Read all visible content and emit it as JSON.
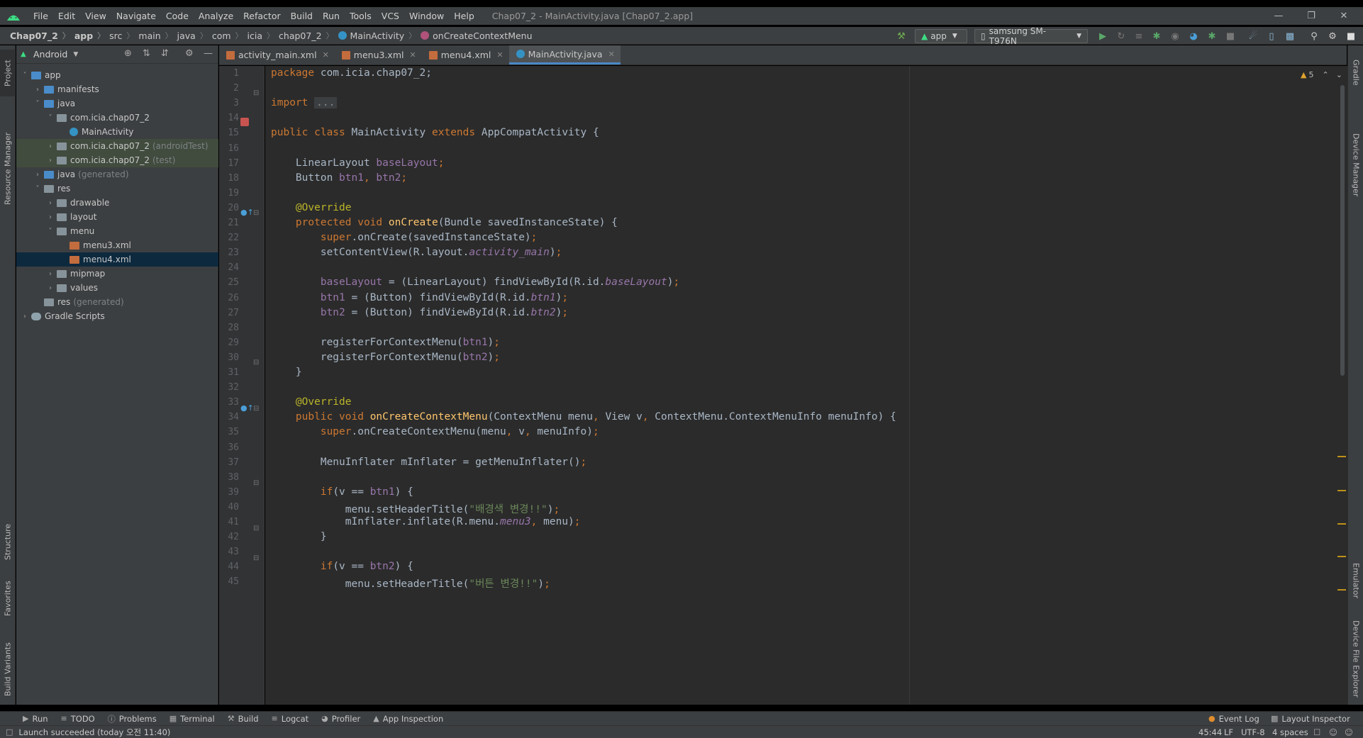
{
  "menubar": {
    "items": [
      "File",
      "Edit",
      "View",
      "Navigate",
      "Code",
      "Analyze",
      "Refactor",
      "Build",
      "Run",
      "Tools",
      "VCS",
      "Window",
      "Help"
    ],
    "window_title": "Chap07_2 - MainActivity.java [Chap07_2.app]"
  },
  "breadcrumb": [
    "Chap07_2",
    "app",
    "src",
    "main",
    "java",
    "com",
    "icia",
    "chap07_2",
    "MainActivity",
    "onCreateContextMenu"
  ],
  "toolbar": {
    "run_config": "app",
    "device": "samsung SM-T976N"
  },
  "project": {
    "view_mode": "Android",
    "tree": [
      {
        "label": "app",
        "level": 0,
        "chev": "v",
        "icon": "folder-blue",
        "muted": "",
        "state": ""
      },
      {
        "label": "manifests",
        "level": 1,
        "chev": ">",
        "icon": "folder-blue",
        "muted": "",
        "state": ""
      },
      {
        "label": "java",
        "level": 1,
        "chev": "v",
        "icon": "folder-blue",
        "muted": "",
        "state": ""
      },
      {
        "label": "com.icia.chap07_2",
        "level": 2,
        "chev": "v",
        "icon": "folder",
        "muted": "",
        "state": ""
      },
      {
        "label": "MainActivity",
        "level": 3,
        "chev": "",
        "icon": "java",
        "muted": "",
        "state": ""
      },
      {
        "label": "com.icia.chap07_2",
        "level": 2,
        "chev": ">",
        "icon": "folder",
        "muted": "(androidTest)",
        "state": "green"
      },
      {
        "label": "com.icia.chap07_2",
        "level": 2,
        "chev": ">",
        "icon": "folder",
        "muted": "(test)",
        "state": "green"
      },
      {
        "label": "java",
        "level": 1,
        "chev": ">",
        "icon": "folder-blue",
        "muted": "(generated)",
        "state": ""
      },
      {
        "label": "res",
        "level": 1,
        "chev": "v",
        "icon": "folder",
        "muted": "",
        "state": ""
      },
      {
        "label": "drawable",
        "level": 2,
        "chev": ">",
        "icon": "folder",
        "muted": "",
        "state": ""
      },
      {
        "label": "layout",
        "level": 2,
        "chev": ">",
        "icon": "folder",
        "muted": "",
        "state": ""
      },
      {
        "label": "menu",
        "level": 2,
        "chev": "v",
        "icon": "folder",
        "muted": "",
        "state": ""
      },
      {
        "label": "menu3.xml",
        "level": 3,
        "chev": "",
        "icon": "xml",
        "muted": "",
        "state": ""
      },
      {
        "label": "menu4.xml",
        "level": 3,
        "chev": "",
        "icon": "xml",
        "muted": "",
        "state": "selected"
      },
      {
        "label": "mipmap",
        "level": 2,
        "chev": ">",
        "icon": "folder",
        "muted": "",
        "state": ""
      },
      {
        "label": "values",
        "level": 2,
        "chev": ">",
        "icon": "folder",
        "muted": "",
        "state": ""
      },
      {
        "label": "res",
        "level": 1,
        "chev": "",
        "icon": "folder",
        "muted": "(generated)",
        "state": ""
      },
      {
        "label": "Gradle Scripts",
        "level": 0,
        "chev": ">",
        "icon": "gradle",
        "muted": "",
        "state": ""
      }
    ]
  },
  "tabs": [
    {
      "label": "activity_main.xml",
      "icon": "xml",
      "active": false
    },
    {
      "label": "menu3.xml",
      "icon": "xml",
      "active": false
    },
    {
      "label": "menu4.xml",
      "icon": "xml",
      "active": false
    },
    {
      "label": "MainActivity.java",
      "icon": "java",
      "active": true
    }
  ],
  "editor": {
    "warning_count": "5",
    "line_numbers": [
      "1",
      "2",
      "3",
      "14",
      "15",
      "16",
      "17",
      "18",
      "19",
      "20",
      "21",
      "22",
      "23",
      "24",
      "25",
      "26",
      "27",
      "28",
      "29",
      "30",
      "31",
      "32",
      "33",
      "34",
      "35",
      "36",
      "37",
      "38",
      "39",
      "40",
      "41",
      "42",
      "43",
      "44",
      "45"
    ],
    "code_lines": [
      [
        {
          "t": "kw",
          "v": "package "
        },
        {
          "t": "",
          "v": "com.icia.chap07_2;"
        }
      ],
      [],
      [
        {
          "t": "kw",
          "v": "import "
        },
        {
          "t": "fold",
          "v": "..."
        }
      ],
      [],
      [
        {
          "t": "kw",
          "v": "public class "
        },
        {
          "t": "",
          "v": "MainActivity "
        },
        {
          "t": "kw",
          "v": "extends "
        },
        {
          "t": "",
          "v": "AppCompatActivity {"
        }
      ],
      [],
      [
        {
          "t": "",
          "v": "    LinearLayout "
        },
        {
          "t": "fld",
          "v": "baseLayout"
        },
        {
          "t": "kw",
          "v": ";"
        }
      ],
      [
        {
          "t": "",
          "v": "    Button "
        },
        {
          "t": "fld",
          "v": "btn1"
        },
        {
          "t": "kw",
          "v": ", "
        },
        {
          "t": "fld",
          "v": "btn2"
        },
        {
          "t": "kw",
          "v": ";"
        }
      ],
      [],
      [
        {
          "t": "ann",
          "v": "    @Override"
        }
      ],
      [
        {
          "t": "kw",
          "v": "    protected void "
        },
        {
          "t": "fn",
          "v": "onCreate"
        },
        {
          "t": "",
          "v": "(Bundle savedInstanceState) {"
        }
      ],
      [
        {
          "t": "kw",
          "v": "        super"
        },
        {
          "t": "",
          "v": ".onCreate(savedInstanceState)"
        },
        {
          "t": "kw",
          "v": ";"
        }
      ],
      [
        {
          "t": "",
          "v": "        setContentView(R.layout."
        },
        {
          "t": "fldi",
          "v": "activity_main"
        },
        {
          "t": "",
          "v": ")"
        },
        {
          "t": "kw",
          "v": ";"
        }
      ],
      [],
      [
        {
          "t": "fld",
          "v": "        baseLayout "
        },
        {
          "t": "",
          "v": "= (LinearLayout) findViewById(R.id."
        },
        {
          "t": "fldi",
          "v": "baseLayout"
        },
        {
          "t": "",
          "v": ")"
        },
        {
          "t": "kw",
          "v": ";"
        }
      ],
      [
        {
          "t": "fld",
          "v": "        btn1 "
        },
        {
          "t": "",
          "v": "= (Button) findViewById(R.id."
        },
        {
          "t": "fldi",
          "v": "btn1"
        },
        {
          "t": "",
          "v": ")"
        },
        {
          "t": "kw",
          "v": ";"
        }
      ],
      [
        {
          "t": "fld",
          "v": "        btn2 "
        },
        {
          "t": "",
          "v": "= (Button) findViewById(R.id."
        },
        {
          "t": "fldi",
          "v": "btn2"
        },
        {
          "t": "",
          "v": ")"
        },
        {
          "t": "kw",
          "v": ";"
        }
      ],
      [],
      [
        {
          "t": "",
          "v": "        registerForContextMenu("
        },
        {
          "t": "fld",
          "v": "btn1"
        },
        {
          "t": "",
          "v": ")"
        },
        {
          "t": "kw",
          "v": ";"
        }
      ],
      [
        {
          "t": "",
          "v": "        registerForContextMenu("
        },
        {
          "t": "fld",
          "v": "btn2"
        },
        {
          "t": "",
          "v": ")"
        },
        {
          "t": "kw",
          "v": ";"
        }
      ],
      [
        {
          "t": "",
          "v": "    }"
        }
      ],
      [],
      [
        {
          "t": "ann",
          "v": "    @Override"
        }
      ],
      [
        {
          "t": "kw",
          "v": "    public void "
        },
        {
          "t": "fn",
          "v": "onCreateContextMenu"
        },
        {
          "t": "",
          "v": "(ContextMenu menu"
        },
        {
          "t": "kw",
          "v": ", "
        },
        {
          "t": "",
          "v": "View v"
        },
        {
          "t": "kw",
          "v": ", "
        },
        {
          "t": "",
          "v": "ContextMenu.ContextMenuInfo menuInfo) {"
        }
      ],
      [
        {
          "t": "kw",
          "v": "        super"
        },
        {
          "t": "",
          "v": ".onCreateContextMenu(menu"
        },
        {
          "t": "kw",
          "v": ", "
        },
        {
          "t": "",
          "v": "v"
        },
        {
          "t": "kw",
          "v": ", "
        },
        {
          "t": "",
          "v": "menuInfo)"
        },
        {
          "t": "kw",
          "v": ";"
        }
      ],
      [],
      [
        {
          "t": "",
          "v": "        MenuInflater mInflater = getMenuInflater()"
        },
        {
          "t": "kw",
          "v": ";"
        }
      ],
      [],
      [
        {
          "t": "kw",
          "v": "        if"
        },
        {
          "t": "",
          "v": "(v == "
        },
        {
          "t": "fld",
          "v": "btn1"
        },
        {
          "t": "",
          "v": ") {"
        }
      ],
      [
        {
          "t": "",
          "v": "            menu.setHeaderTitle("
        },
        {
          "t": "str",
          "v": "\"배경색 변경!!\""
        },
        {
          "t": "",
          "v": ")"
        },
        {
          "t": "kw",
          "v": ";"
        }
      ],
      [
        {
          "t": "",
          "v": "            mInflater.inflate(R.menu."
        },
        {
          "t": "fldi",
          "v": "menu3"
        },
        {
          "t": "kw",
          "v": ", "
        },
        {
          "t": "",
          "v": "menu)"
        },
        {
          "t": "kw",
          "v": ";"
        }
      ],
      [
        {
          "t": "",
          "v": "        }"
        }
      ],
      [],
      [
        {
          "t": "kw",
          "v": "        if"
        },
        {
          "t": "",
          "v": "(v == "
        },
        {
          "t": "fld",
          "v": "btn2"
        },
        {
          "t": "",
          "v": ") {"
        }
      ],
      [
        {
          "t": "",
          "v": "            menu.setHeaderTitle("
        },
        {
          "t": "str",
          "v": "\"버튼 변경!!\""
        },
        {
          "t": "",
          "v": ")"
        },
        {
          "t": "kw",
          "v": ";"
        }
      ]
    ]
  },
  "left_tabs": [
    "Project",
    "Resource Manager",
    "Structure",
    "Favorites",
    "Build Variants"
  ],
  "right_tabs": [
    "Gradle",
    "Device Manager",
    "Emulator",
    "Device File Explorer"
  ],
  "bottom_tools": [
    "Run",
    "TODO",
    "Problems",
    "Terminal",
    "Build",
    "Logcat",
    "Profiler",
    "App Inspection"
  ],
  "bottom_right_tools": [
    "Event Log",
    "Layout Inspector"
  ],
  "status": {
    "message": "Launch succeeded (today 오전 11:40)",
    "caret": "45:44",
    "line_sep": "LF",
    "encoding": "UTF-8",
    "indent": "4 spaces"
  }
}
